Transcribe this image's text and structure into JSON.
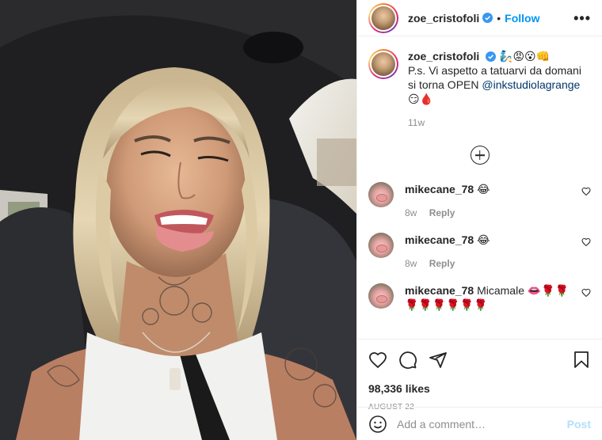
{
  "post": {
    "username": "zoe_cristofoli",
    "follow_label": "Follow",
    "separator": "•",
    "more_label": "•••",
    "caption": {
      "emojis": "🧞😡😮👊",
      "text": "P.s. Vi aspetto a tatuarvi da domani si torna OPEN",
      "mention": "@inkstudiolagrange",
      "trailing_emojis": "😏🩸",
      "time": "11w"
    },
    "comments": [
      {
        "username": "mikecane_78",
        "text": "😂",
        "time": "8w",
        "reply_label": "Reply"
      },
      {
        "username": "mikecane_78",
        "text": "😂",
        "time": "8w",
        "reply_label": "Reply"
      },
      {
        "username": "mikecane_78",
        "text": "Micamale 👄🌹🌹🌹🌹🌹🌹🌹🌹",
        "time": "",
        "reply_label": ""
      }
    ],
    "likes": "98,336 likes",
    "date": "AUGUST 22",
    "add_comment_placeholder": "Add a comment…",
    "post_button": "Post"
  },
  "colors": {
    "accent": "#0095f6",
    "verified": "#3897f0",
    "post_disabled": "#b2dffc",
    "muted": "#8e8e8e"
  }
}
